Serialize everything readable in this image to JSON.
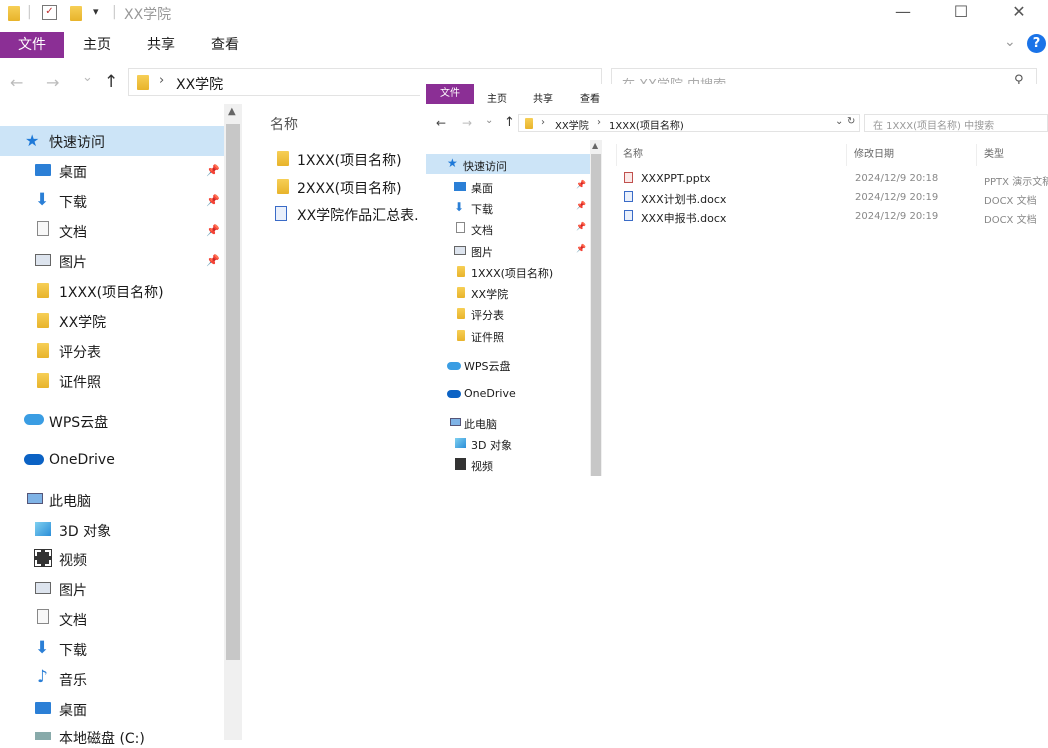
{
  "window": {
    "title": "XX学院",
    "minimize": "—",
    "maximize": "☐",
    "close": "✕"
  },
  "ribbon": {
    "tabs": [
      "文件",
      "主页",
      "共享",
      "查看"
    ]
  },
  "address": {
    "back": "←",
    "forward": "→",
    "recent": "⌄",
    "up": "↑",
    "crumb": "XX学院",
    "search_placeholder": "在 XX学院 中搜索"
  },
  "sidebar": {
    "quick_access": "快速访问",
    "pinned": [
      "桌面",
      "下载",
      "文档",
      "图片"
    ],
    "folders": [
      "1XXX(项目名称)",
      "XX学院",
      "评分表",
      "证件照"
    ],
    "wps": "WPS云盘",
    "onedrive": "OneDrive",
    "this_pc": "此电脑",
    "pc_items": [
      "3D 对象",
      "视频",
      "图片",
      "文档",
      "下载",
      "音乐",
      "桌面",
      "本地磁盘 (C:)"
    ]
  },
  "main": {
    "column_name": "名称",
    "items": [
      "1XXX(项目名称)",
      "2XXX(项目名称)",
      "XX学院作品汇总表."
    ]
  },
  "inner": {
    "tabs": [
      "文件",
      "主页",
      "共享",
      "查看"
    ],
    "crumbs": [
      "XX学院",
      "1XXX(项目名称)"
    ],
    "search_placeholder": "在 1XXX(项目名称) 中搜索",
    "sidebar": {
      "quick_access": "快速访问",
      "pinned": [
        "桌面",
        "下载",
        "文档",
        "图片"
      ],
      "folders": [
        "1XXX(项目名称)",
        "XX学院",
        "评分表",
        "证件照"
      ],
      "wps": "WPS云盘",
      "onedrive": "OneDrive",
      "this_pc": "此电脑",
      "pc_items": [
        "3D 对象",
        "视频"
      ]
    },
    "columns": {
      "name": "名称",
      "date": "修改日期",
      "type": "类型"
    },
    "files": [
      {
        "name": "XXXPPT.pptx",
        "date": "2024/12/9 20:18",
        "type": "PPTX 演示文稿"
      },
      {
        "name": "XXX计划书.docx",
        "date": "2024/12/9 20:19",
        "type": "DOCX 文档"
      },
      {
        "name": "XXX申报书.docx",
        "date": "2024/12/9 20:19",
        "type": "DOCX 文档"
      }
    ]
  },
  "colors": {
    "file_tab": "#8b2f95",
    "help": "#1a73e8",
    "folder": "#f0c040"
  }
}
